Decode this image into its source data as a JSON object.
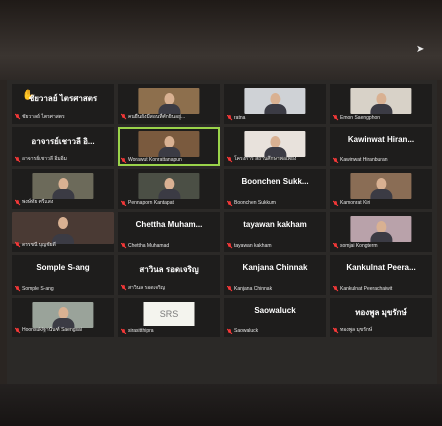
{
  "participants": [
    {
      "name": "ชัยวาลย์ ไตรศาสตร",
      "caption": "ชัยวาลย์ ไตรศาสตร",
      "video": false,
      "hand_raised": true
    },
    {
      "name": "",
      "caption": "คนยืนยังมีสอนที่ศักยินอยู่...",
      "video": true,
      "bg": "#8d6f4d"
    },
    {
      "name": "",
      "caption": "ratna",
      "video": true,
      "bg": "#cfd2d6"
    },
    {
      "name": "",
      "caption": "Emon Saengphon",
      "video": true,
      "bg": "#d8d2c8"
    },
    {
      "name": "อาจารย์เชาวลี อิ...",
      "caption": "อาจารย์เชาวลี อิ่มอิ่ม",
      "video": false
    },
    {
      "name": "",
      "caption": "Worawut Konrattanapun",
      "video": true,
      "bg": "#7a5a3e",
      "active": true
    },
    {
      "name": "",
      "caption": "โครงการ สถานศึกษาพอเพียง",
      "video": true,
      "bg": "#e8e2dc"
    },
    {
      "name": "Kawinwat Hiran...",
      "caption": "Kawinwat Hiranburan",
      "video": false
    },
    {
      "name": "",
      "caption": "พงษ์ทัย ศรีแสง",
      "video": true,
      "bg": "#6c6a5a"
    },
    {
      "name": "",
      "caption": "Pennaporn Kantapat",
      "video": true,
      "bg": "#4b4f45"
    },
    {
      "name": "Boonchen Sukk...",
      "caption": "Boonchen Sukkum",
      "video": false
    },
    {
      "name": "",
      "caption": "Kamonrat Kiri",
      "video": true,
      "bg": "#8a6d55"
    },
    {
      "name": "",
      "caption": "ดรรชนี บุญชัยดี",
      "video": true,
      "bg": "#4a3a34",
      "wide": true
    },
    {
      "name": "Chettha Muham...",
      "caption": "Chettha Muhamad",
      "video": false
    },
    {
      "name": "tayawan kakham",
      "caption": "tayawan kakham",
      "video": false
    },
    {
      "name": "",
      "caption": "somjai Kongterm",
      "video": true,
      "bg": "#b9a2aa"
    },
    {
      "name": "Somple S-ang",
      "caption": "Somple S-ang",
      "video": false
    },
    {
      "name": "สาวินล รอดเจริญ",
      "caption": "สาวินล รอดเจริญ",
      "video": false
    },
    {
      "name": "Kanjana Chinnak",
      "caption": "Kanjana Chinnak",
      "video": false
    },
    {
      "name": "Kankulnat Peera...",
      "caption": "Kankulnat Peerachaiwit",
      "video": false
    },
    {
      "name": "",
      "caption": "Hoonsuk/ฐานันฑ์ Saengsai",
      "video": true,
      "bg": "#9aa39a"
    },
    {
      "name": "",
      "caption": "sirasitthipra",
      "video": true,
      "bg": "#f1efe6",
      "srs": true
    },
    {
      "name": "Saowaluck",
      "caption": "Saowaluck",
      "video": false
    },
    {
      "name": "ทองพูล มุขรักษ์",
      "caption": "ทองพูล มุขรักษ์",
      "video": false
    }
  ],
  "srs_text": "SRS"
}
